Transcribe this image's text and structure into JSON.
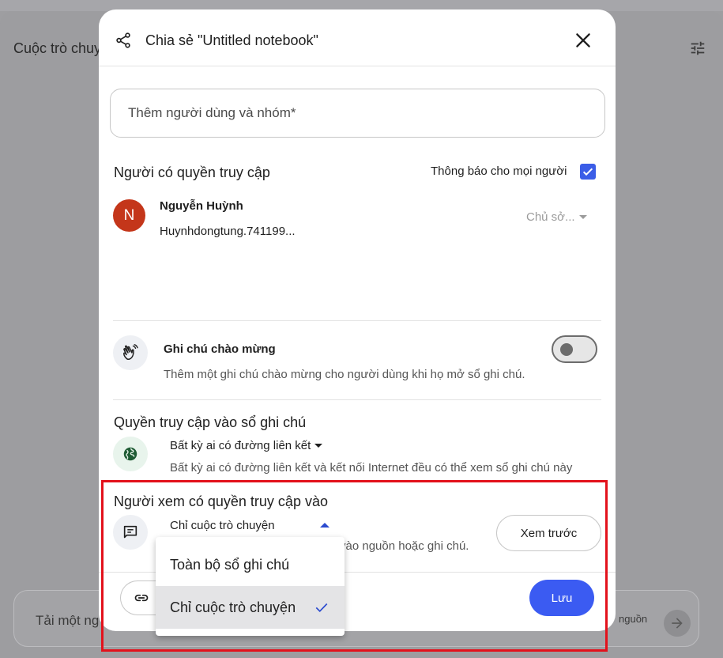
{
  "background": {
    "title": "Cuộc trò chuy",
    "input_placeholder": "Tải một ng",
    "source_hint": "nguồn",
    "icons": {
      "tune": "tune-icon",
      "send": "arrow-right-icon"
    }
  },
  "dialog": {
    "title": "Chia sẻ \"Untitled notebook\"",
    "icons": {
      "share": "share-icon",
      "close": "close-icon"
    },
    "add_people_placeholder": "Thêm người dùng và nhóm*",
    "people_with_access": {
      "heading": "Người có quyền truy cập",
      "notify_label": "Thông báo cho mọi người",
      "notify_checked": true,
      "users": [
        {
          "initial": "N",
          "name": "Nguyễn Huỳnh",
          "email": "Huynhdongtung.741199...",
          "role": "Chủ sở..."
        }
      ]
    },
    "welcome_note": {
      "icon": "waving-hand-icon",
      "title": "Ghi chú chào mừng",
      "description": "Thêm một ghi chú chào mừng cho người dùng khi họ mở sổ ghi chú.",
      "enabled": false
    },
    "notebook_access": {
      "heading": "Quyền truy cập vào sổ ghi chú",
      "icon": "globe-icon",
      "selected": "Bất kỳ ai có đường liên kết",
      "description": "Bất kỳ ai có đường liên kết và kết nối Internet đều có thể xem sổ ghi chú này"
    },
    "viewer_access": {
      "heading": "Người xem có quyền truy cập vào",
      "icon": "chat-icon",
      "selected": "Chỉ cuộc trò chuyện",
      "description_visible": "vào nguồn hoặc ghi chú.",
      "preview_label": "Xem trước",
      "menu_options": [
        {
          "label": "Toàn bộ sổ ghi chú",
          "selected": false
        },
        {
          "label": "Chỉ cuộc trò chuyện",
          "selected": true
        }
      ]
    },
    "footer": {
      "link_icon": "link-icon",
      "save_label": "Lưu"
    }
  },
  "colors": {
    "accent": "#3b5bf2",
    "checkbox": "#3b5de7",
    "avatar": "#c4361a",
    "highlight": "#e3111b",
    "globe_bg": "#e8f4ec",
    "globe": "#1e5b34"
  }
}
